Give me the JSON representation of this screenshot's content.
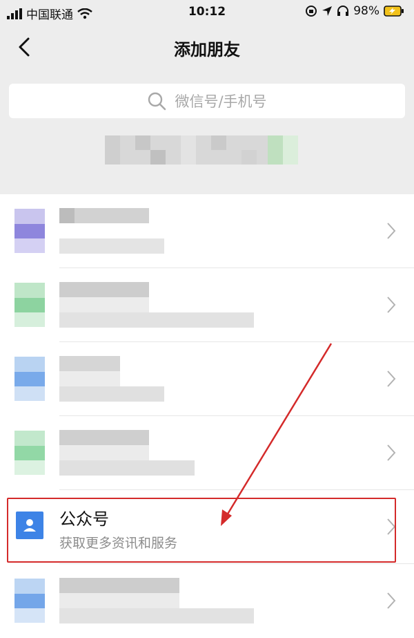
{
  "status_bar": {
    "carrier": "中国联通",
    "time": "10:12",
    "battery": "98%"
  },
  "nav": {
    "title": "添加朋友"
  },
  "search": {
    "placeholder": "微信号/手机号"
  },
  "list": {
    "official_accounts": {
      "title": "公众号",
      "subtitle": "获取更多资讯和服务"
    }
  },
  "colors": {
    "page_bg": "#ededed",
    "accent_blue": "#3d83e6",
    "annotation_red": "#d42a2a"
  }
}
